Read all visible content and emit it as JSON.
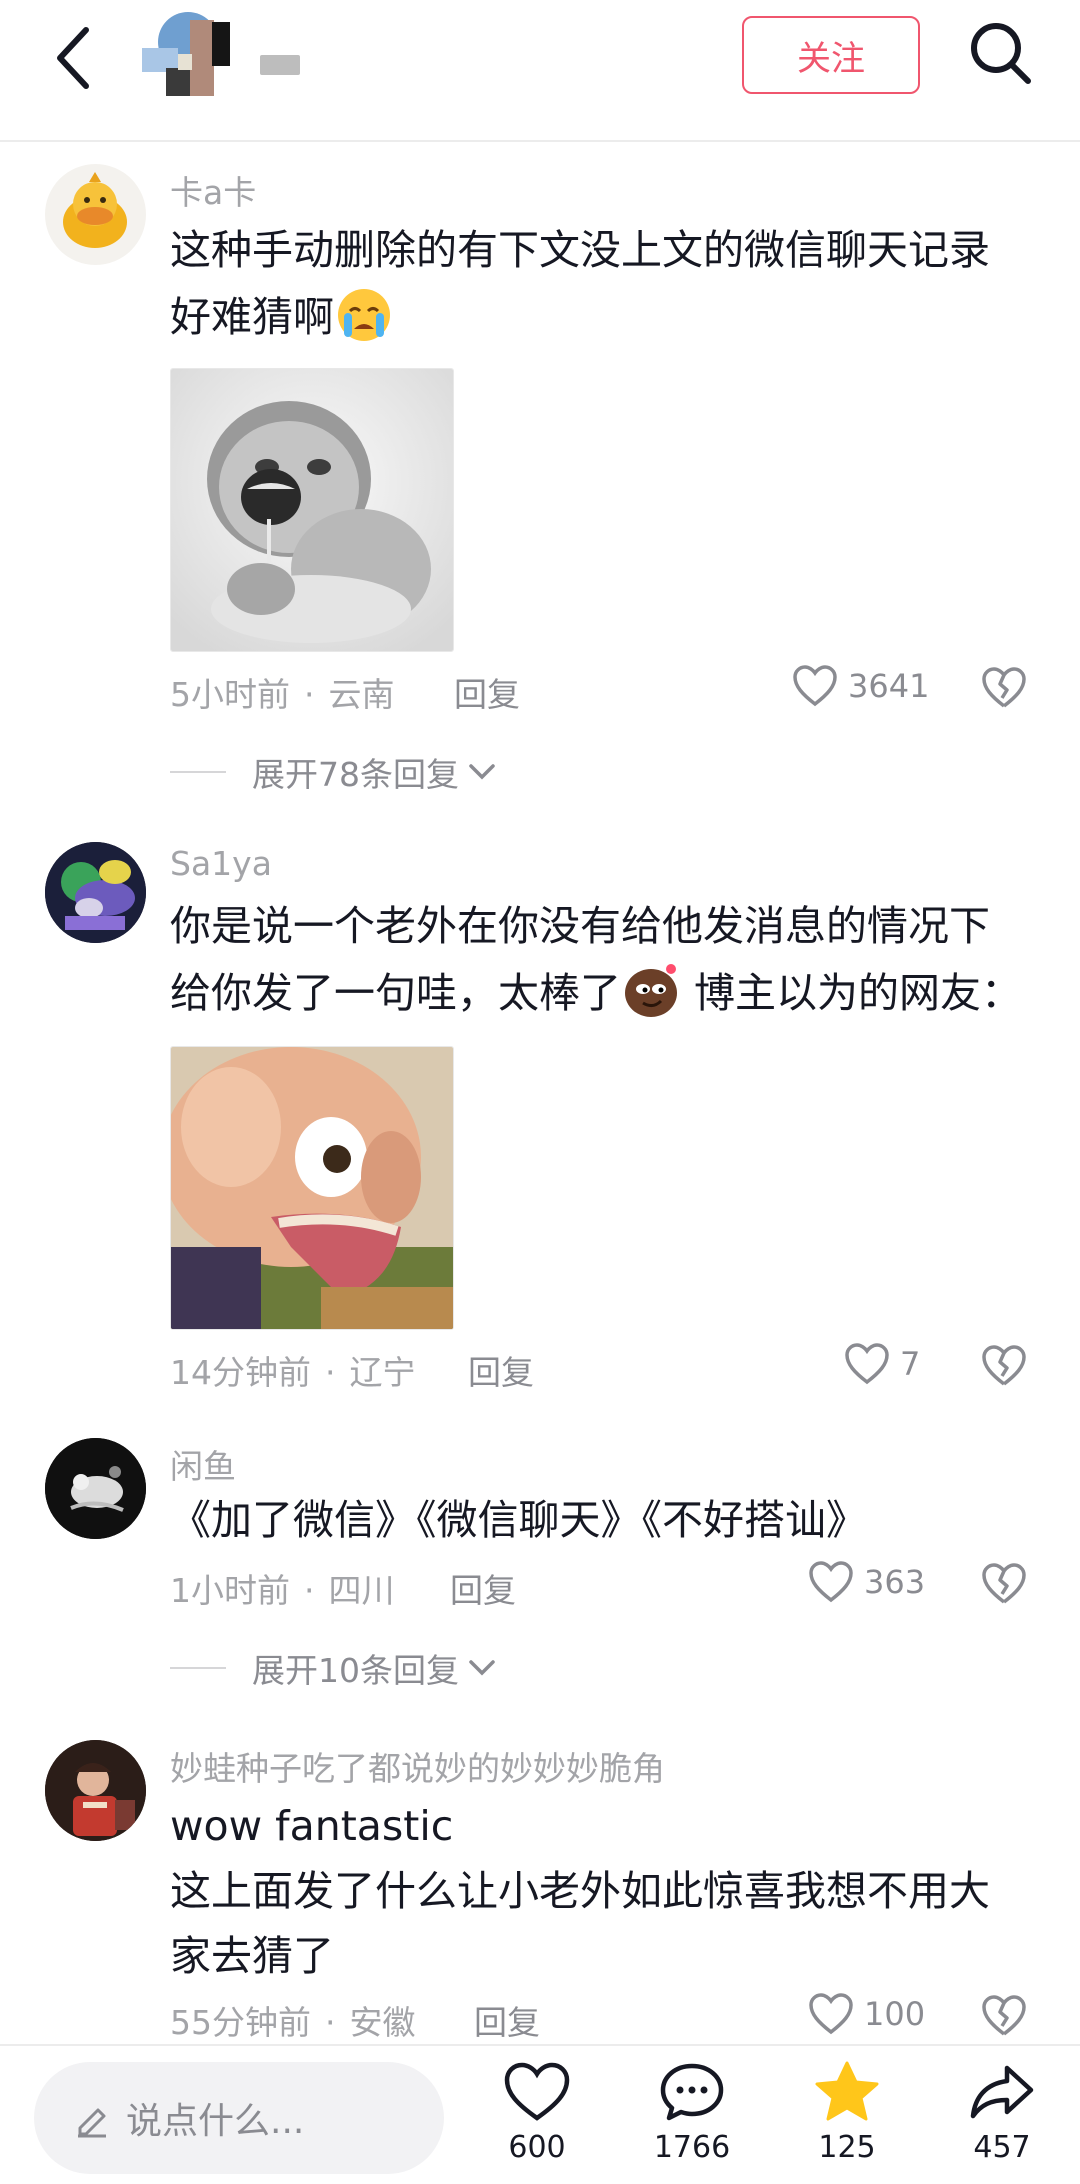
{
  "header": {
    "follow_label": "关注"
  },
  "comments": [
    {
      "username": "卡a卡",
      "lines": [
        "这种手动删除的有下文没上文的微信聊天记录",
        "好难猜啊"
      ],
      "emoji": "crying-face-emoji",
      "time": "5小时前",
      "location": "云南",
      "reply_label": "回复",
      "likes": "3641",
      "expand_label": "展开78条回复"
    },
    {
      "username": "Sa1ya",
      "lines": [
        "你是说一个老外在你没有给他发消息的情况下",
        "给你发了一句哇，太棒了",
        " 博主以为的网友："
      ],
      "emoji": "smirking-potato-emoji",
      "time": "14分钟前",
      "location": "辽宁",
      "reply_label": "回复",
      "likes": "7"
    },
    {
      "username": "闲鱼",
      "lines": [
        "《加了微信》《微信聊天》《不好搭讪》"
      ],
      "time": "1小时前",
      "location": "四川",
      "reply_label": "回复",
      "likes": "363",
      "expand_label": "展开10条回复"
    },
    {
      "username": "妙蛙种子吃了都说妙的妙妙妙脆角",
      "lines": [
        "wow fantastic",
        "这上面发了什么让小老外如此惊喜我想不用大",
        "家去猜了"
      ],
      "time": "55分钟前",
      "location": "安徽",
      "reply_label": "回复",
      "likes": "100"
    }
  ],
  "bottom_bar": {
    "input_placeholder": "说点什么...",
    "likes": "600",
    "comments": "1766",
    "favorites": "125",
    "shares": "457"
  },
  "colors": {
    "accent": "#f0566e",
    "star": "#ffc61a",
    "secondary_text": "#a3a4a8"
  }
}
